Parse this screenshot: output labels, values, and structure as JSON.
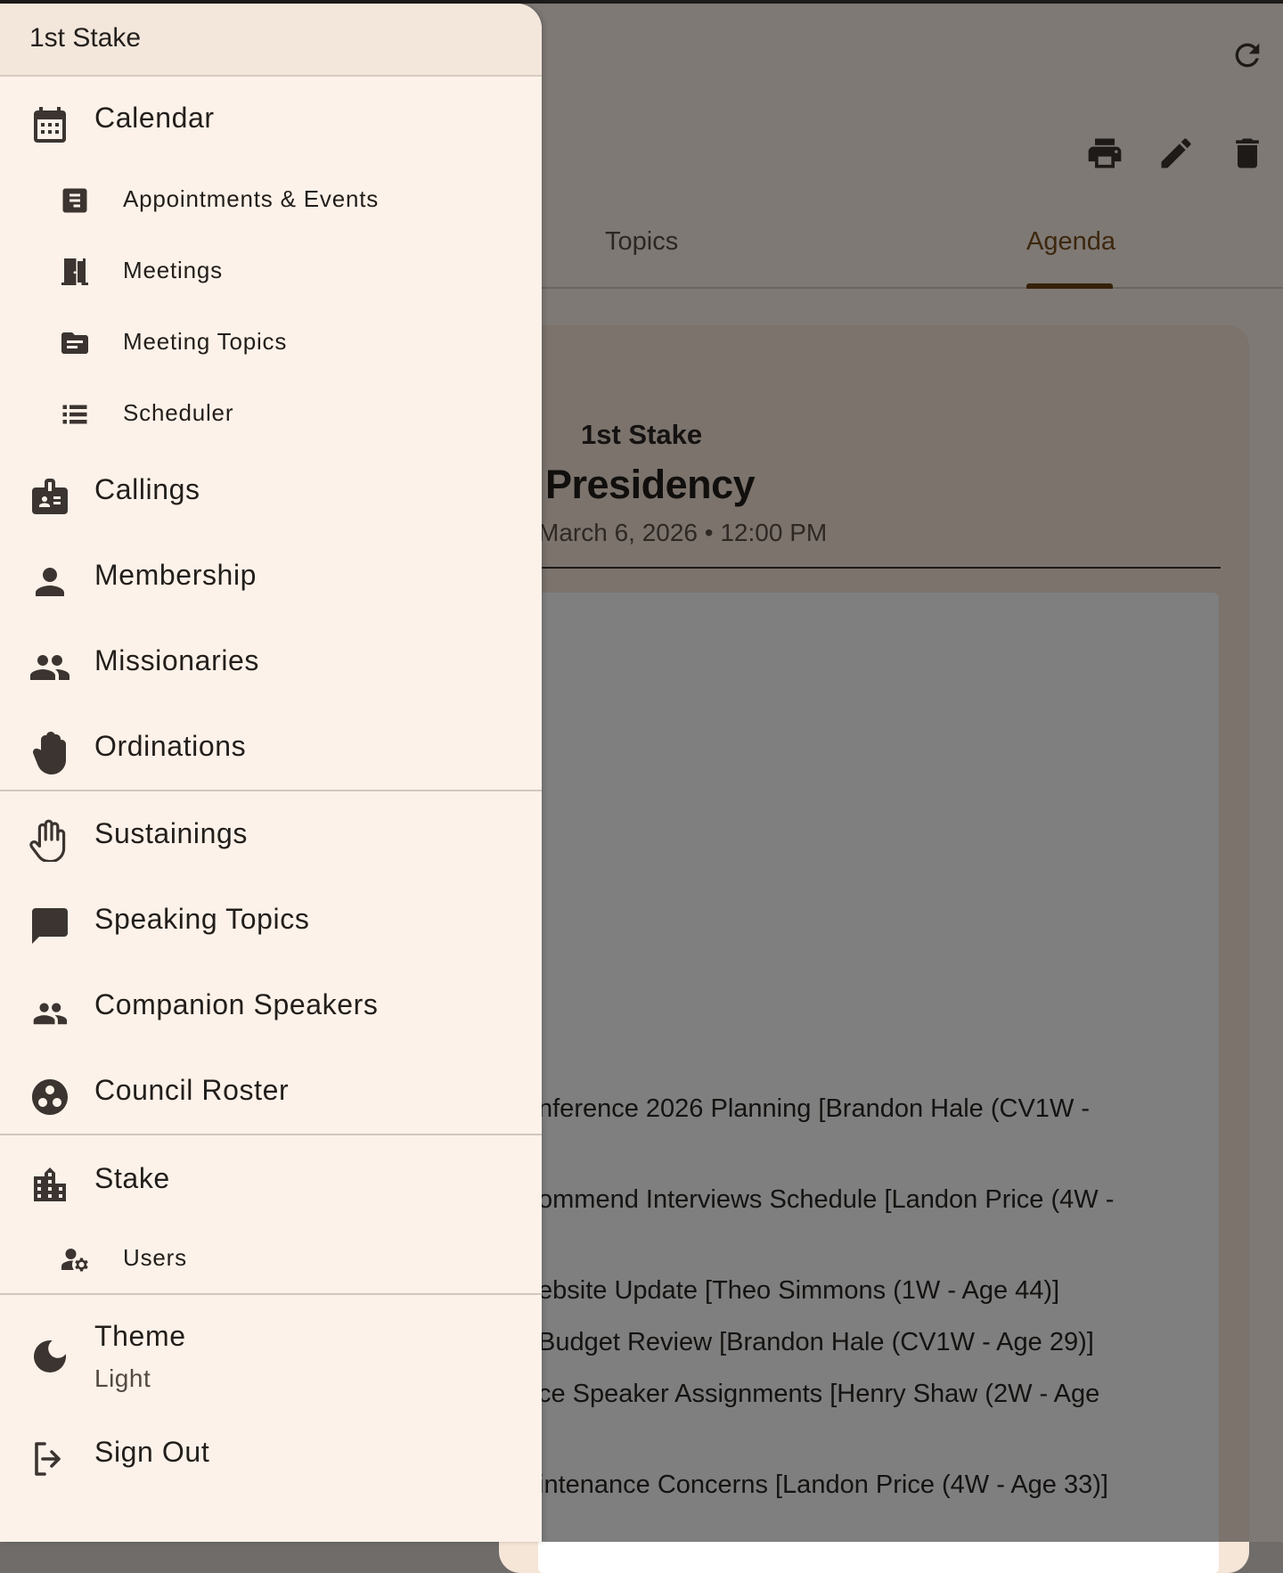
{
  "drawer": {
    "title": "1st Stake",
    "calendar": {
      "label": "Calendar",
      "children": [
        "Appointments & Events",
        "Meetings",
        "Meeting Topics",
        "Scheduler"
      ]
    },
    "items": [
      "Callings",
      "Membership",
      "Missionaries",
      "Ordinations"
    ],
    "items2": [
      "Sustainings",
      "Speaking Topics",
      "Companion Speakers",
      "Council Roster"
    ],
    "stake": {
      "label": "Stake",
      "children": [
        "Users"
      ]
    },
    "theme": {
      "label": "Theme",
      "value": "Light"
    },
    "sign_out": "Sign Out"
  },
  "background": {
    "tabs": [
      "Topics",
      "Agenda"
    ],
    "active_tab": "Agenda",
    "org_name": "1st Stake",
    "meeting_title": "Presidency",
    "meeting_datetime": "March 6, 2026 • 12:00 PM",
    "agenda_items": [
      "nference 2026 Planning [Brandon Hale (CV1W -",
      "ommend Interviews Schedule [Landon Price (4W -",
      "ebsite Update [Theo Simmons (1W - Age 44)]",
      "Budget Review [Brandon Hale (CV1W - Age 29)]",
      "ce Speaker Assignments [Henry Shaw (2W - Age",
      "intenance Concerns [Landon Price (4W - Age 33)]"
    ]
  },
  "colors": {
    "drawer_bg": "#fdf2e9",
    "accent": "#6b4312",
    "icon": "#3b3430"
  }
}
